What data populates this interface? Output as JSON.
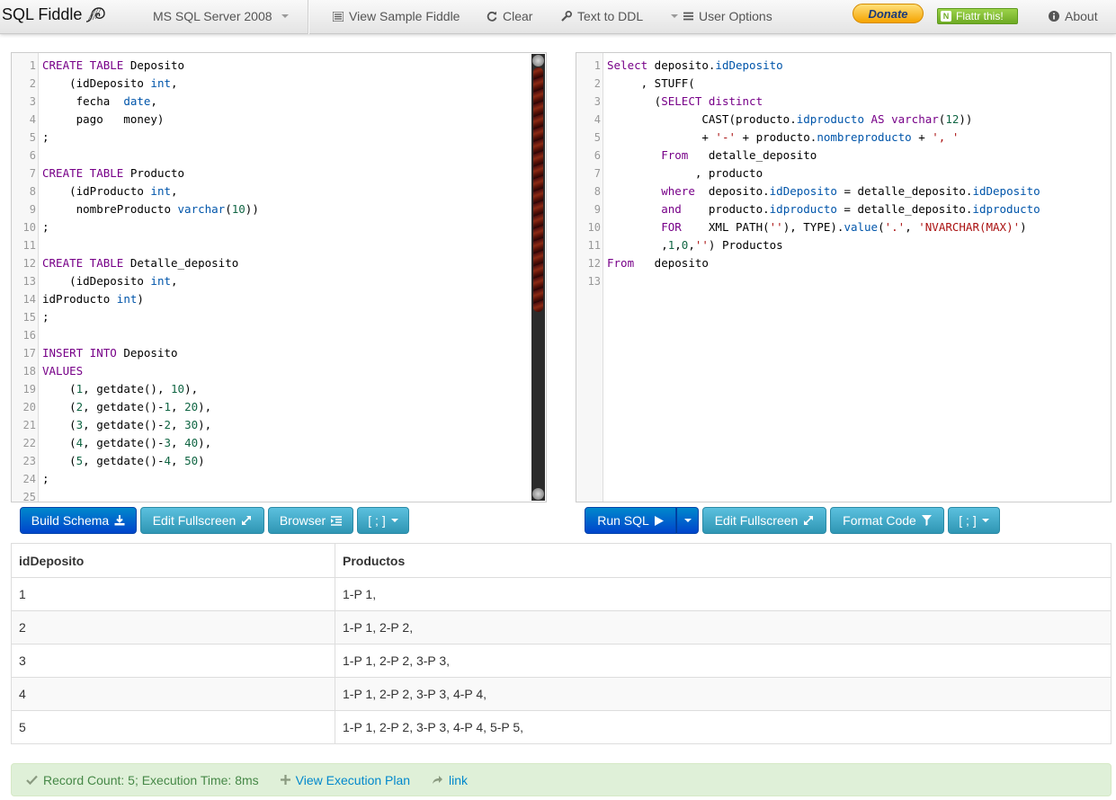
{
  "navbar": {
    "brand": "SQL Fiddle",
    "database": "MS SQL Server 2008",
    "view_sample": "View Sample Fiddle",
    "clear": "Clear",
    "text_to_ddl": "Text to DDL",
    "user_options": "User Options",
    "donate": "Donate",
    "flattr": "Flattr this!",
    "about": "About"
  },
  "schema_editor": {
    "lines": [
      {
        "n": "1",
        "segs": [
          [
            "kw",
            "CREATE TABLE"
          ],
          [
            "",
            "Deposito"
          ]
        ]
      },
      {
        "n": "2",
        "segs": [
          [
            "",
            "    (idDeposito "
          ],
          [
            "ty",
            "int"
          ],
          [
            "",
            ","
          ]
        ]
      },
      {
        "n": "3",
        "segs": [
          [
            "",
            "     fecha  "
          ],
          [
            "ty",
            "date"
          ],
          [
            "",
            ","
          ]
        ]
      },
      {
        "n": "4",
        "segs": [
          [
            "",
            "     pago   money)"
          ]
        ]
      },
      {
        "n": "5",
        "segs": [
          [
            "",
            ";"
          ]
        ]
      },
      {
        "n": "6",
        "segs": []
      },
      {
        "n": "7",
        "segs": [
          [
            "kw",
            "CREATE TABLE"
          ],
          [
            "",
            "Producto"
          ]
        ]
      },
      {
        "n": "8",
        "segs": [
          [
            "",
            "    (idProducto "
          ],
          [
            "ty",
            "int"
          ],
          [
            "",
            ","
          ]
        ]
      },
      {
        "n": "9",
        "segs": [
          [
            "",
            "     nombreProducto "
          ],
          [
            "ty",
            "varchar"
          ],
          [
            "",
            "("
          ],
          [
            "nm",
            "10"
          ],
          [
            "",
            "))"
          ]
        ]
      },
      {
        "n": "10",
        "segs": [
          [
            "",
            ";"
          ]
        ]
      },
      {
        "n": "11",
        "segs": []
      },
      {
        "n": "12",
        "segs": [
          [
            "kw",
            "CREATE TABLE"
          ],
          [
            "",
            "Detalle_deposito"
          ]
        ]
      },
      {
        "n": "13",
        "segs": [
          [
            "",
            "    (idDeposito "
          ],
          [
            "ty",
            "int"
          ],
          [
            "",
            ","
          ]
        ]
      },
      {
        "n": "14",
        "segs": [
          [
            "",
            "idProducto "
          ],
          [
            "ty",
            "int"
          ],
          [
            "",
            ")"
          ]
        ]
      },
      {
        "n": "15",
        "segs": [
          [
            "",
            ";"
          ]
        ]
      },
      {
        "n": "16",
        "segs": []
      },
      {
        "n": "17",
        "segs": [
          [
            "kw",
            "INSERT INTO"
          ],
          [
            "",
            "Deposito"
          ]
        ]
      },
      {
        "n": "18",
        "segs": [
          [
            "kw",
            "VALUES"
          ]
        ]
      },
      {
        "n": "19",
        "segs": [
          [
            "",
            "    ("
          ],
          [
            "nm",
            "1"
          ],
          [
            "",
            ", getdate(), "
          ],
          [
            "nm",
            "10"
          ],
          [
            "",
            "),"
          ]
        ]
      },
      {
        "n": "20",
        "segs": [
          [
            "",
            "    ("
          ],
          [
            "nm",
            "2"
          ],
          [
            "",
            ", getdate()-"
          ],
          [
            "nm",
            "1"
          ],
          [
            "",
            ", "
          ],
          [
            "nm",
            "20"
          ],
          [
            "",
            "),"
          ]
        ]
      },
      {
        "n": "21",
        "segs": [
          [
            "",
            "    ("
          ],
          [
            "nm",
            "3"
          ],
          [
            "",
            ", getdate()-"
          ],
          [
            "nm",
            "2"
          ],
          [
            "",
            ", "
          ],
          [
            "nm",
            "30"
          ],
          [
            "",
            "),"
          ]
        ]
      },
      {
        "n": "22",
        "segs": [
          [
            "",
            "    ("
          ],
          [
            "nm",
            "4"
          ],
          [
            "",
            ", getdate()-"
          ],
          [
            "nm",
            "3"
          ],
          [
            "",
            ", "
          ],
          [
            "nm",
            "40"
          ],
          [
            "",
            "),"
          ]
        ]
      },
      {
        "n": "23",
        "segs": [
          [
            "",
            "    ("
          ],
          [
            "nm",
            "5"
          ],
          [
            "",
            ", getdate()-"
          ],
          [
            "nm",
            "4"
          ],
          [
            "",
            ", "
          ],
          [
            "nm",
            "50"
          ],
          [
            "",
            ")"
          ]
        ]
      },
      {
        "n": "24",
        "segs": [
          [
            "",
            ";"
          ]
        ]
      },
      {
        "n": "25",
        "segs": []
      }
    ]
  },
  "query_editor": {
    "lines": [
      {
        "n": "1",
        "segs": [
          [
            "kw",
            "Select"
          ],
          [
            "",
            " deposito."
          ],
          [
            "ty",
            "idDeposito"
          ]
        ]
      },
      {
        "n": "2",
        "segs": [
          [
            "",
            "     , STUFF("
          ]
        ]
      },
      {
        "n": "3",
        "segs": [
          [
            "",
            "       ("
          ],
          [
            "kw",
            "SELECT distinct"
          ]
        ]
      },
      {
        "n": "4",
        "segs": [
          [
            "",
            "              CAST(producto."
          ],
          [
            "ty",
            "idproducto"
          ],
          [
            "",
            ""
          ],
          [
            "kw",
            " AS"
          ],
          [
            "",
            " "
          ],
          [
            "kw",
            "varchar"
          ],
          [
            "",
            "("
          ],
          [
            "nm",
            "12"
          ],
          [
            "",
            "))"
          ]
        ]
      },
      {
        "n": "5",
        "segs": [
          [
            "",
            "              + "
          ],
          [
            "st",
            "'-'"
          ],
          [
            "",
            " + producto."
          ],
          [
            "ty",
            "nombreproducto"
          ],
          [
            "",
            " + "
          ],
          [
            "st",
            "', '"
          ]
        ]
      },
      {
        "n": "6",
        "segs": [
          [
            "",
            "        "
          ],
          [
            "kw",
            "From"
          ],
          [
            "",
            "   detalle_deposito"
          ]
        ]
      },
      {
        "n": "7",
        "segs": [
          [
            "",
            "             , producto"
          ]
        ]
      },
      {
        "n": "8",
        "segs": [
          [
            "",
            "        "
          ],
          [
            "kw",
            "where"
          ],
          [
            "",
            "  deposito."
          ],
          [
            "ty",
            "idDeposito"
          ],
          [
            "",
            " = detalle_deposito."
          ],
          [
            "ty",
            "idDeposito"
          ]
        ]
      },
      {
        "n": "9",
        "segs": [
          [
            "",
            "        "
          ],
          [
            "kw",
            "and"
          ],
          [
            "",
            "    producto."
          ],
          [
            "ty",
            "idproducto"
          ],
          [
            "",
            " = detalle_deposito."
          ],
          [
            "ty",
            "idproducto"
          ]
        ]
      },
      {
        "n": "10",
        "segs": [
          [
            "",
            "        "
          ],
          [
            "kw",
            "FOR"
          ],
          [
            "",
            "    XML PATH("
          ],
          [
            "st",
            "''"
          ],
          [
            "",
            "), TYPE)."
          ],
          [
            "ty",
            "value"
          ],
          [
            "",
            "("
          ],
          [
            "st",
            "'.'"
          ],
          [
            "",
            ", "
          ],
          [
            "st",
            "'NVARCHAR(MAX)'"
          ],
          [
            "",
            ")"
          ]
        ]
      },
      {
        "n": "11",
        "segs": [
          [
            "",
            "        ,"
          ],
          [
            "nm",
            "1"
          ],
          [
            "",
            ","
          ],
          [
            "nm",
            "0"
          ],
          [
            "",
            ","
          ],
          [
            "st",
            "''"
          ],
          [
            "",
            ") Productos"
          ]
        ]
      },
      {
        "n": "12",
        "segs": [
          [
            "kw",
            "From"
          ],
          [
            "",
            "   deposito"
          ]
        ]
      },
      {
        "n": "13",
        "segs": []
      }
    ]
  },
  "schema_buttons": {
    "build_schema": "Build Schema",
    "edit_fullscreen": "Edit Fullscreen",
    "browser": "Browser",
    "delimiter": "[ ; ]"
  },
  "query_buttons": {
    "run_sql": "Run SQL",
    "edit_fullscreen": "Edit Fullscreen",
    "format_code": "Format Code",
    "delimiter": "[ ; ]"
  },
  "results": {
    "columns": [
      "idDeposito",
      "Productos"
    ],
    "rows": [
      [
        "1",
        "1-P 1,"
      ],
      [
        "2",
        "1-P 1, 2-P 2,"
      ],
      [
        "3",
        "1-P 1, 2-P 2, 3-P 3,"
      ],
      [
        "4",
        "1-P 1, 2-P 2, 3-P 3, 4-P 4,"
      ],
      [
        "5",
        "1-P 1, 2-P 2, 3-P 3, 4-P 4, 5-P 5,"
      ]
    ]
  },
  "status": {
    "summary": "Record Count: 5; Execution Time: 8ms",
    "execution_plan": "View Execution Plan",
    "link": "link"
  },
  "icons": {
    "brand": "seashell-logo-icon",
    "view_sample": "list-icon",
    "clear": "refresh-icon",
    "text_to_ddl": "wrench-icon",
    "user_options": "list-icon",
    "about": "info-circle-icon",
    "build_schema": "download-icon",
    "edit_fullscreen": "resize-full-icon",
    "browser": "indent-icon",
    "run_sql": "play-icon",
    "format_code": "filter-icon",
    "status_ok": "check-icon",
    "execution_plan": "plus-icon",
    "link": "share-arrow-icon"
  },
  "colors": {
    "primary_button": "#0055cc",
    "info_button": "#49afcd",
    "status_background": "#dff0d8",
    "status_text": "#468847",
    "link": "#0088cc"
  }
}
